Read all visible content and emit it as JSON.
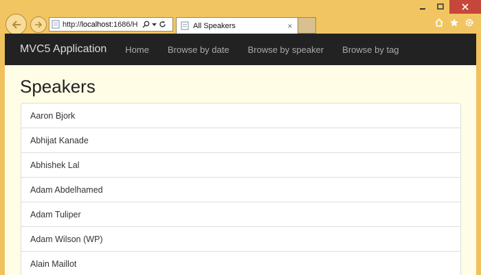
{
  "browser": {
    "address_url_prefix": "http://",
    "address_url_host": "localhost",
    "address_url_rest": ":1686/H",
    "tab_title": "All Speakers",
    "tab_close": "×"
  },
  "navbar": {
    "brand": "MVC5 Application",
    "links": [
      "Home",
      "Browse by date",
      "Browse by speaker",
      "Browse by tag"
    ]
  },
  "page": {
    "title": "Speakers",
    "speakers": [
      "Aaron Bjork",
      "Abhijat Kanade",
      "Abhishek Lal",
      "Adam Abdelhamed",
      "Adam Tuliper",
      "Adam Wilson (WP)",
      "Alain Maillot"
    ]
  },
  "colors": {
    "window_chrome": "#f1c662",
    "close_button": "#c7463b",
    "navbar_bg": "#222222",
    "page_bg": "#fffde6"
  }
}
